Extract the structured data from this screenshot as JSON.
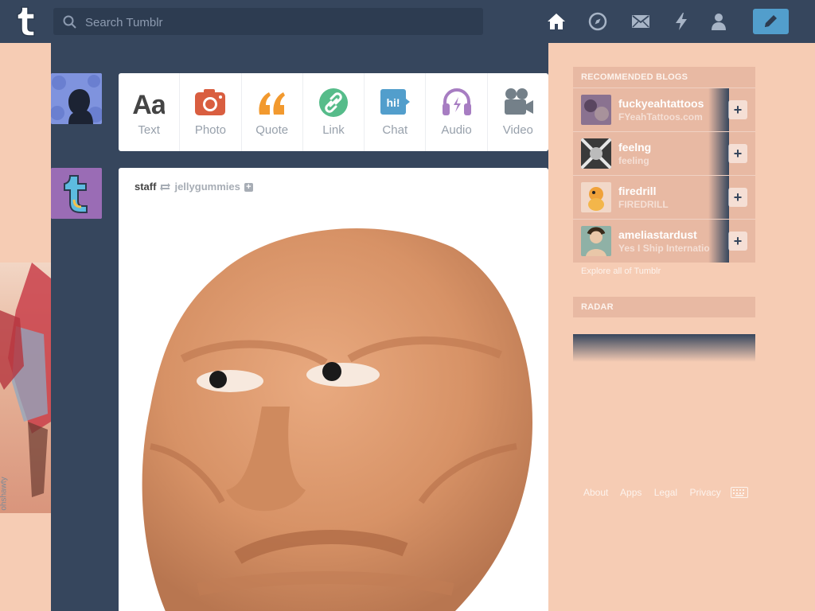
{
  "search": {
    "placeholder": "Search Tumblr"
  },
  "nav": {
    "icons": [
      "home-icon",
      "compass-icon",
      "mail-icon",
      "lightning-icon",
      "account-icon",
      "compose-pencil-icon"
    ]
  },
  "left_art": {
    "credit": "ohshawty"
  },
  "post_types": [
    {
      "label": "Text",
      "color": "#444444"
    },
    {
      "label": "Photo",
      "color": "#d95e40"
    },
    {
      "label": "Quote",
      "color": "#f2992e"
    },
    {
      "label": "Link",
      "color": "#56bc8a"
    },
    {
      "label": "Chat",
      "color": "#529ecc"
    },
    {
      "label": "Audio",
      "color": "#a77dc2"
    },
    {
      "label": "Video",
      "color": "#748089"
    }
  ],
  "post": {
    "author": "staff",
    "reblogged_from": "jellygummies"
  },
  "sidebar": {
    "recommended_heading": "RECOMMENDED BLOGS",
    "blogs": [
      {
        "name": "fuckyeahtattoos",
        "subtitle": "FYeahTattoos.com"
      },
      {
        "name": "feelng",
        "subtitle": "feeling"
      },
      {
        "name": "firedrill",
        "subtitle": "FIREDRILL"
      },
      {
        "name": "ameliastardust",
        "subtitle": "Yes I Ship Internatio"
      }
    ],
    "explore": "Explore all of Tumblr",
    "radar_heading": "RADAR"
  },
  "footer": {
    "links": [
      "About",
      "Apps",
      "Legal",
      "Privacy"
    ]
  },
  "colors": {
    "navy": "#36465d",
    "background": "#f6ccb4",
    "compose_blue": "#529ecc"
  }
}
